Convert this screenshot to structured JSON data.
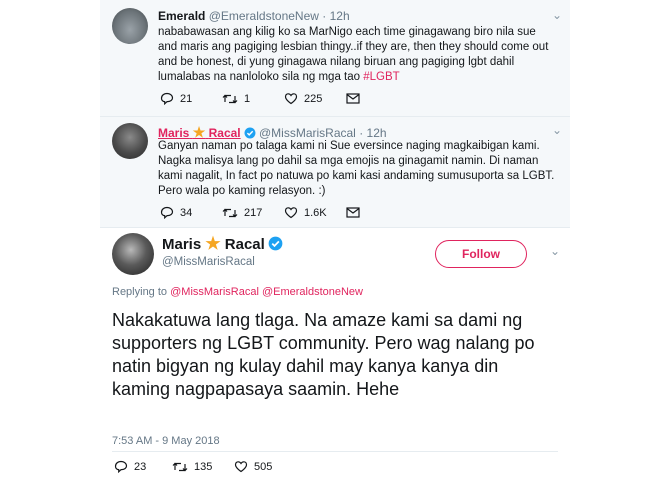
{
  "tweets": [
    {
      "name": "Emerald",
      "handle": "@EmeraldstoneNew",
      "time": "· 12h",
      "text": "nababawasan ang kilig ko sa MarNigo each time ginagawang biro nila sue and maris ang pagiging lesbian thingy..if they are, then they should come out and be honest, di yung ginagawa nilang biruan ang pagiging lgbt dahil lumalabas na nanloloko sila ng mga tao ",
      "hashtag": "#LGBT",
      "replies": "21",
      "retweets": "1",
      "likes": "225"
    },
    {
      "name_first": "Maris",
      "name_last": "Racal",
      "handle": "@MissMarisRacal",
      "time": "· 12h",
      "text": "Ganyan naman po talaga kami ni Sue eversince naging magkaibigan kami. Nagka malisya lang po dahil sa mga emojis na ginagamit namin. Di naman kami nagalit, In fact po natuwa po kami kasi andaming sumusuporta sa LGBT. Pero wala po kaming relasyon. :)",
      "replies": "34",
      "retweets": "217",
      "likes": "1.6K"
    }
  ],
  "main_tweet": {
    "name_first": "Maris",
    "name_last": "Racal",
    "handle": "@MissMarisRacal",
    "follow_label": "Follow",
    "replying_prefix": "Replying to",
    "replying_to": "@MissMarisRacal @EmeraldstoneNew",
    "text": "Nakakatuwa lang tlaga. Na amaze kami sa dami ng supporters ng LGBT community. Pero wag nalang po natin bigyan ng kulay dahil may kanya kanya din kaming nagpapasaya saamin. Hehe",
    "timestamp": "7:53 AM - 9 May 2018",
    "replies": "23",
    "retweets": "135",
    "likes": "505"
  },
  "colors": {
    "accent": "#e0245e",
    "verified": "#1da1f2",
    "star": "#f5a623",
    "muted": "#657786"
  },
  "icons": {
    "reply": "reply-icon",
    "retweet": "retweet-icon",
    "like": "heart-icon",
    "dm": "envelope-icon",
    "verified": "verified-badge-icon",
    "star": "star-icon",
    "more": "chevron-down-icon"
  }
}
